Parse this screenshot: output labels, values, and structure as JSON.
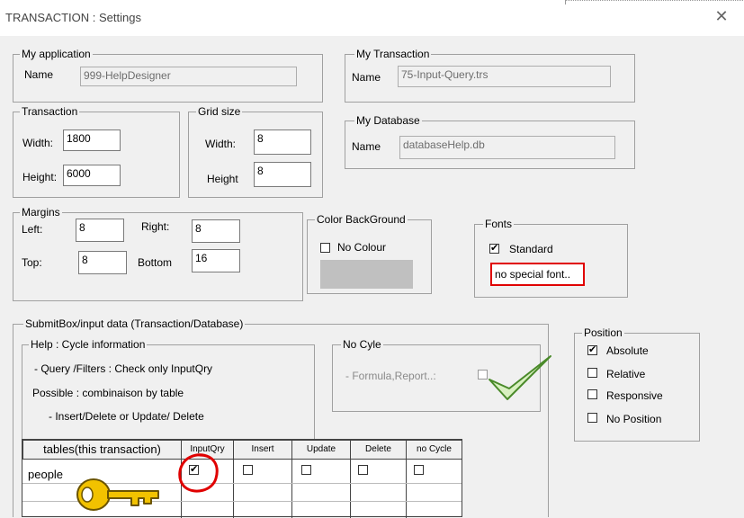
{
  "window": {
    "title": "TRANSACTION : Settings",
    "close_label": "✕"
  },
  "my_application": {
    "legend": "My application",
    "name_label": "Name",
    "name_value": "999-HelpDesigner"
  },
  "my_transaction": {
    "legend": "My Transaction",
    "name_label": "Name",
    "name_value": "75-Input-Query.trs"
  },
  "my_database": {
    "legend": "My  Database",
    "name_label": "Name",
    "name_value": "databaseHelp.db"
  },
  "transaction": {
    "legend": "Transaction",
    "width_label": "Width:",
    "width_value": "1800",
    "height_label": "Height:",
    "height_value": "6000"
  },
  "grid_size": {
    "legend": "Grid size",
    "width_label": "Width:",
    "width_value": "8",
    "height_label": "Height",
    "height_value": "8"
  },
  "margins": {
    "legend": "Margins",
    "left_label": "Left:",
    "left_value": "8",
    "right_label": "Right:",
    "right_value": "8",
    "top_label": "Top:",
    "top_value": "8",
    "bottom_label": "Bottom",
    "bottom_value": "16"
  },
  "color_background": {
    "legend": "Color BackGround",
    "no_colour_label": "No Colour",
    "no_colour_checked": false,
    "swatch_color": "#c0c0c0"
  },
  "fonts": {
    "legend": "Fonts",
    "standard_label": "Standard",
    "standard_checked": true,
    "note": "no special font.."
  },
  "submitbox": {
    "legend": "SubmitBox/input data (Transaction/Database)"
  },
  "help": {
    "legend": "Help : Cycle information",
    "line1": "- Query /Filters    : Check only InputQry",
    "line2": "Possible : combinaison by table",
    "line3": "- Insert/Delete or  Update/ Delete"
  },
  "no_cycle": {
    "legend": "No Cyle",
    "label": "- Formula,Report..:"
  },
  "position": {
    "legend": "Position",
    "options": [
      {
        "label": "Absolute",
        "checked": true
      },
      {
        "label": "Relative",
        "checked": false
      },
      {
        "label": "Responsive",
        "checked": false
      },
      {
        "label": "No Position",
        "checked": false
      }
    ]
  },
  "table": {
    "columns": [
      "tables(this transaction)",
      "InputQry",
      "Insert",
      "Update",
      "Delete",
      "no Cycle"
    ],
    "rows": [
      {
        "name": "people",
        "input_qry": true,
        "insert": false,
        "update": false,
        "delete": false,
        "no_cycle": false
      }
    ]
  },
  "colors": {
    "highlight_red": "#e00000",
    "check_green": "#4a8a2a",
    "key_gold": "#f2c200"
  },
  "icons": [
    "close-icon",
    "key-icon",
    "green-checkmark-icon",
    "red-circle-highlight"
  ]
}
